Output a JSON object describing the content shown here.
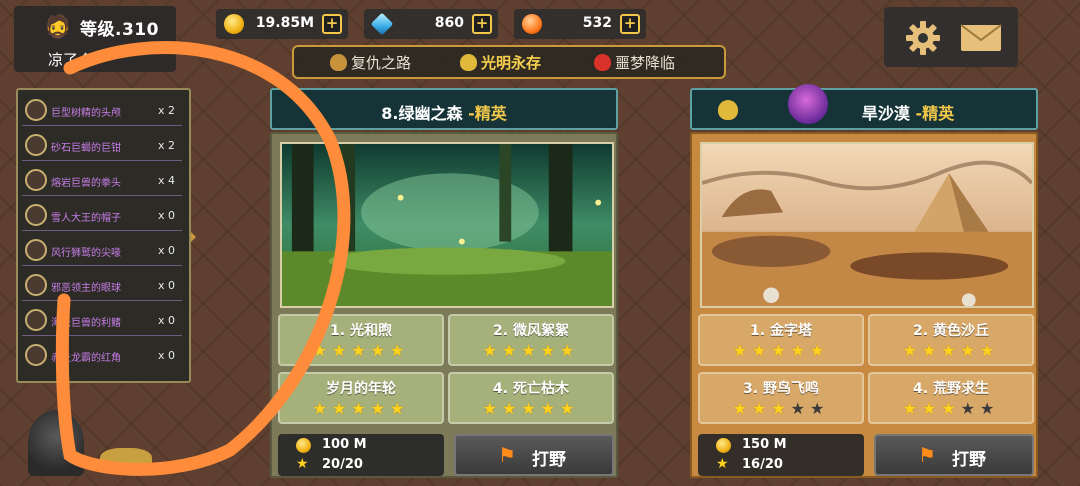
{
  "player": {
    "level": "等级.310",
    "name": "凉了个",
    "avatar_icon": "viking-avatar-icon"
  },
  "resources": [
    {
      "icon": "gold-coin-icon",
      "value": "19.85M",
      "color": "#f1b214"
    },
    {
      "icon": "diamond-icon",
      "value": "860",
      "color": "#3aaee6"
    },
    {
      "icon": "orb-icon",
      "value": "532",
      "color": "#ff7a1c"
    }
  ],
  "top_buttons": {
    "settings_icon": "gear-icon",
    "mail_icon": "mail-icon"
  },
  "tabs": [
    {
      "label": "复仇之路",
      "icon": "heart-shield-icon",
      "active": false
    },
    {
      "label": "光明永存",
      "icon": "star-shield-icon",
      "active": true
    },
    {
      "label": "噩梦降临",
      "icon": "warning-shield-icon",
      "active": false
    }
  ],
  "items": [
    {
      "name": "巨型树精的头颅",
      "count": "x 2"
    },
    {
      "name": "砂石巨蝎的巨钳",
      "count": "x 2"
    },
    {
      "name": "熔岩巨兽的拳头",
      "count": "x 4"
    },
    {
      "name": "雪人大王的帽子",
      "count": "x 0"
    },
    {
      "name": "风行狮鹫的尖喙",
      "count": "x 0"
    },
    {
      "name": "邪恶领主的眼球",
      "count": "x 0"
    },
    {
      "name": "海妖巨兽的利鳍",
      "count": "x 0"
    },
    {
      "name": "赤炎龙霸的红角",
      "count": "x 0"
    }
  ],
  "cards": [
    {
      "title": "8.绿幽之森",
      "tag": "-精英",
      "stages": [
        {
          "name": "1. 光和煦",
          "stars": 5
        },
        {
          "name": "2. 微风絮絮",
          "stars": 5
        },
        {
          "name": "岁月的年轮",
          "stars": 5
        },
        {
          "name": "4. 死亡枯木",
          "stars": 5
        }
      ],
      "cost": "100 M",
      "stamina": "20/20",
      "fight_label": "打野"
    },
    {
      "title": "旱沙漠",
      "tag": "-精英",
      "stages": [
        {
          "name": "1. 金字塔",
          "stars": 5
        },
        {
          "name": "2. 黄色沙丘",
          "stars": 5
        },
        {
          "name": "3. 野鸟飞鸣",
          "stars": 3
        },
        {
          "name": "4. 荒野求生",
          "stars": 3
        }
      ],
      "cost": "150 M",
      "stamina": "16/20",
      "fight_label": "打野"
    }
  ],
  "colors": {
    "accent": "#f2c84a",
    "item_text": "#c77ee8",
    "annotation": "#ff8c3a"
  }
}
